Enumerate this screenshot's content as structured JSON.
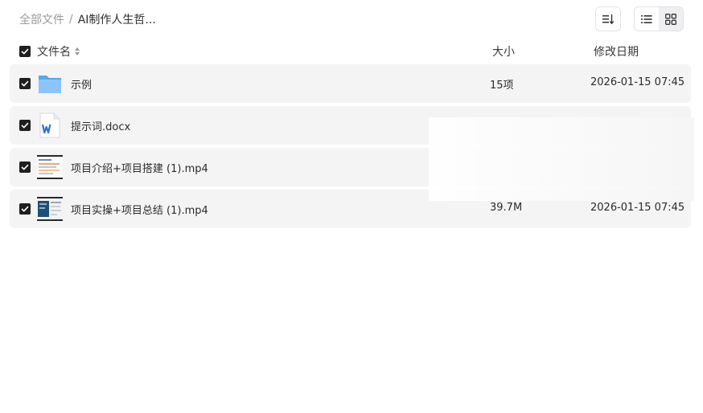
{
  "breadcrumb": {
    "root": "全部文件",
    "separator": "/",
    "current": "AI制作人生哲..."
  },
  "toolbar": {
    "sort_icon": "sort-lines-icon",
    "list_view_icon": "list-view-icon",
    "grid_view_icon": "grid-view-icon",
    "active_view": "grid"
  },
  "header": {
    "name": "文件名",
    "size": "大小",
    "date": "修改日期"
  },
  "files": [
    {
      "name": "示例",
      "size": "15项",
      "date": "2026-01-15 07:45",
      "icon": "folder-icon",
      "checked": true
    },
    {
      "name": "提示词.docx",
      "size": "",
      "date": "",
      "icon": "word-doc-icon",
      "checked": true
    },
    {
      "name": "项目介绍+项目搭建 (1).mp4",
      "size": "",
      "date": "",
      "icon": "video-thumbnail-icon",
      "checked": true
    },
    {
      "name": "项目实操+项目总结 (1).mp4",
      "size": "39.7M",
      "date": "2026-01-15 07:45",
      "icon": "video-thumbnail-icon",
      "checked": true
    }
  ],
  "colors": {
    "row_bg": "#f4f4f5",
    "checkbox": "#1f1f1f",
    "folder": "#6fb3f5",
    "word_blue": "#2f6fd6"
  }
}
